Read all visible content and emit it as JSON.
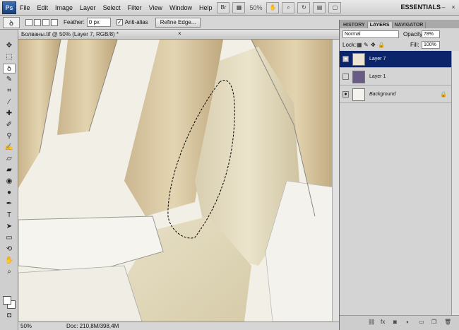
{
  "app": {
    "logo": "Ps",
    "workspace": "ESSENTIALS"
  },
  "menu": [
    "File",
    "Edit",
    "Image",
    "Layer",
    "Select",
    "Filter",
    "View",
    "Window",
    "Help"
  ],
  "menubar": {
    "br_label": "Br",
    "zoom": "50%"
  },
  "options": {
    "feather_label": "Feather:",
    "feather_value": "0 px",
    "antialias_label": "Anti-alias",
    "antialias_checked": true,
    "refine_label": "Refine Edge..."
  },
  "document": {
    "tab_title": "Болваны.tif @ 50% (Layer 7, RGB/8) *",
    "close": "×"
  },
  "status": {
    "zoom": "50%",
    "doc": "Doc: 210,8M/398,4M"
  },
  "panel": {
    "tabs": [
      "HISTORY",
      "LAYERS",
      "NAVIGATOR"
    ],
    "active_tab": "LAYERS",
    "blend_mode": "Normal",
    "opacity_label": "Opacity:",
    "opacity_value": "78%",
    "lock_label": "Lock:",
    "fill_label": "Fill:",
    "fill_value": "100%",
    "layers": [
      {
        "name": "Layer 7",
        "visible": true,
        "active": true
      },
      {
        "name": "Layer 1",
        "visible": false,
        "active": false
      },
      {
        "name": "Background",
        "visible": true,
        "active": false,
        "locked": true
      }
    ]
  },
  "colors": {
    "selection_blue": "#0b246a",
    "layer1_thumb": "#6a5a86"
  }
}
